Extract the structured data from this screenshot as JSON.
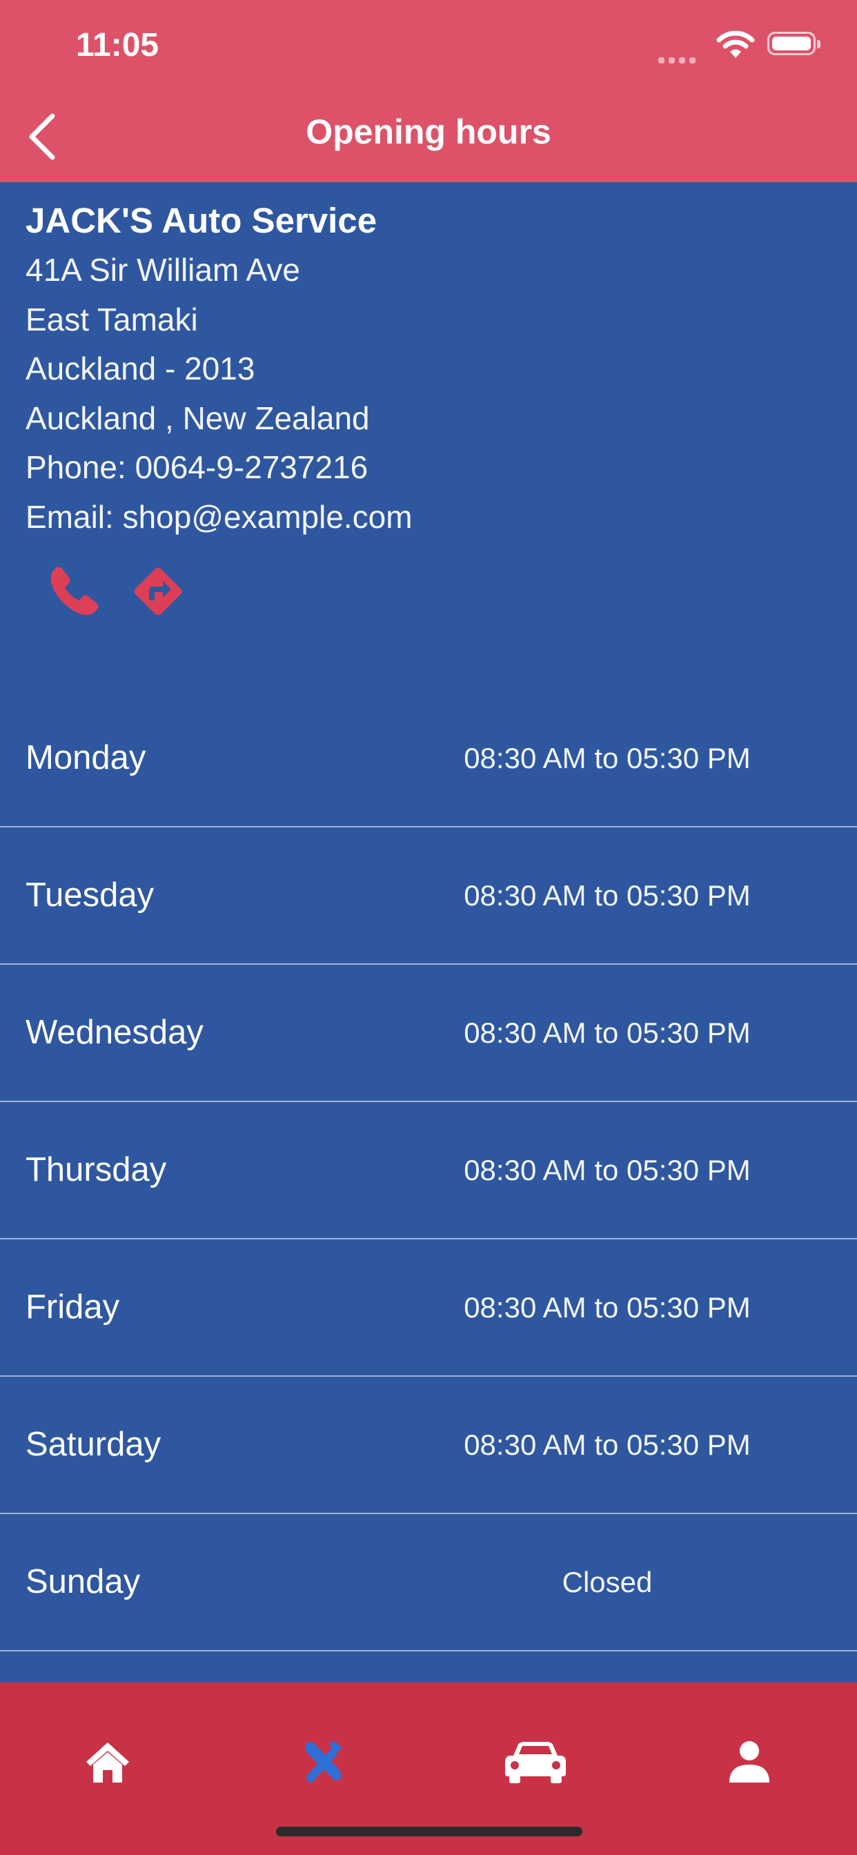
{
  "status_bar": {
    "time": "11:05"
  },
  "header": {
    "title": "Opening hours",
    "back_icon": "chevron-left-icon"
  },
  "shop": {
    "name": "JACK'S Auto Service",
    "address_line1": "41A Sir William Ave",
    "address_line2": "East Tamaki",
    "city_postcode": "Auckland - 2013",
    "region_country": "Auckland , New Zealand",
    "phone": "Phone: 0064-9-2737216",
    "email": "Email: shop@example.com"
  },
  "actions": [
    {
      "icon": "phone-icon"
    },
    {
      "icon": "directions-icon"
    }
  ],
  "hours": [
    {
      "day": "Monday",
      "time": "08:30 AM to 05:30 PM"
    },
    {
      "day": "Tuesday",
      "time": "08:30 AM to 05:30 PM"
    },
    {
      "day": "Wednesday",
      "time": "08:30 AM to 05:30 PM"
    },
    {
      "day": "Thursday",
      "time": "08:30 AM to 05:30 PM"
    },
    {
      "day": "Friday",
      "time": "08:30 AM to 05:30 PM"
    },
    {
      "day": "Saturday",
      "time": "08:30 AM to 05:30 PM"
    },
    {
      "day": "Sunday",
      "time": "Closed"
    }
  ],
  "tab_bar": {
    "tabs": [
      {
        "icon": "home-icon",
        "active": false
      },
      {
        "icon": "tools-icon",
        "active": true
      },
      {
        "icon": "car-icon",
        "active": false
      },
      {
        "icon": "profile-icon",
        "active": false
      }
    ]
  },
  "colors": {
    "header_bg": "#dd5268",
    "content_bg": "#2f57a0",
    "tab_bar_bg": "#c93246",
    "icon_accent": "#dd3f57",
    "active_tab": "#2f6fd6"
  }
}
